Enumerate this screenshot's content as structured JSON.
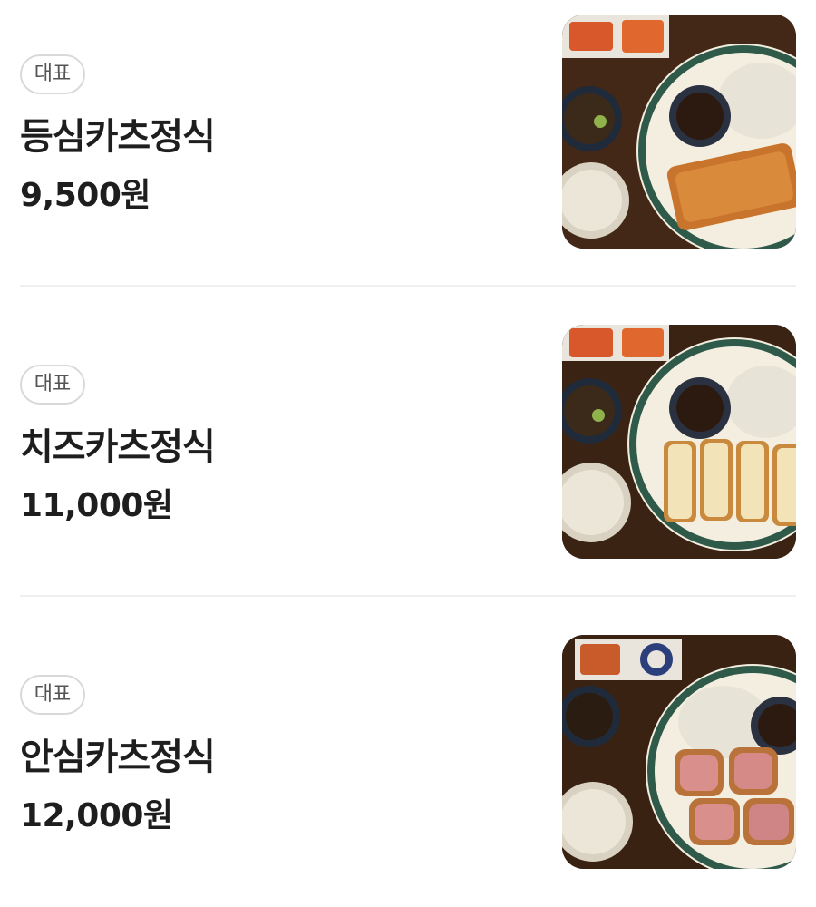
{
  "menu": {
    "items": [
      {
        "badge": "대표",
        "name": "등심카츠정식",
        "price": "9,500원",
        "photo": "pork-loin-katsu-set-photo"
      },
      {
        "badge": "대표",
        "name": "치즈카츠정식",
        "price": "11,000원",
        "photo": "cheese-katsu-set-photo"
      },
      {
        "badge": "대표",
        "name": "안심카츠정식",
        "price": "12,000원",
        "photo": "pork-tenderloin-katsu-set-photo"
      }
    ]
  }
}
